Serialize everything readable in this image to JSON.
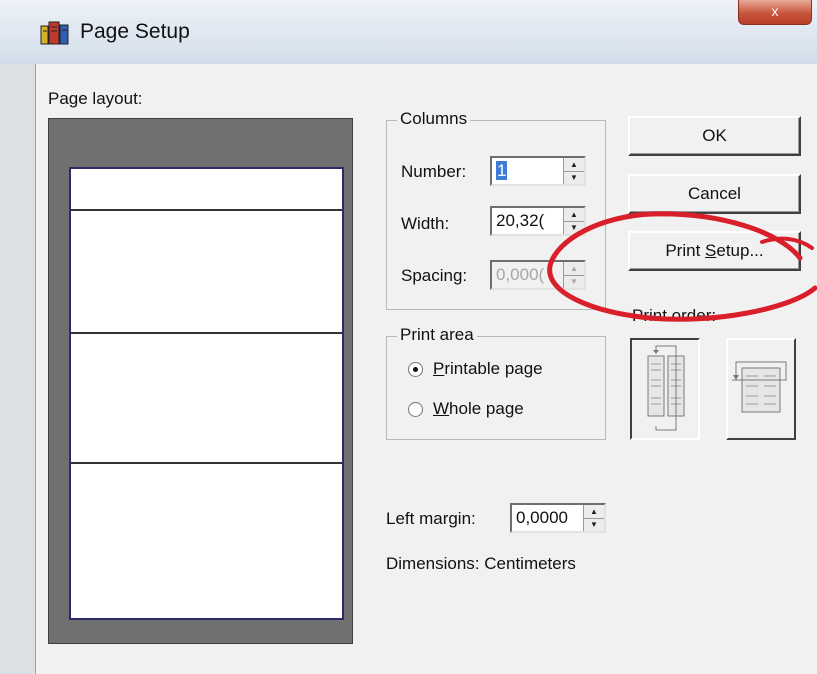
{
  "window": {
    "title": "Page Setup",
    "close_label": "x"
  },
  "page_layout": {
    "label": "Page layout:"
  },
  "columns": {
    "group_label": "Columns",
    "number_label": "Number:",
    "number_value": "1",
    "width_label": "Width:",
    "width_value": "20,32(",
    "spacing_label": "Spacing:",
    "spacing_value": "0,000("
  },
  "print_area": {
    "group_label": "Print area",
    "options": [
      {
        "label": "Printable page",
        "underline": "P",
        "rest": "rintable page",
        "selected": true
      },
      {
        "label": "Whole page",
        "underline": "W",
        "rest": "hole page",
        "selected": false
      }
    ]
  },
  "margin": {
    "left_margin_label": "Left margin:",
    "left_margin_value": "0,0000",
    "dimensions_text": "Dimensions: Centimeters"
  },
  "buttons": {
    "ok": "OK",
    "cancel": "Cancel",
    "print_setup_prefix": "Print ",
    "print_setup_underline": "S",
    "print_setup_suffix": "etup..."
  },
  "print_order": {
    "label": "Print order:",
    "selected": "down-then-over"
  },
  "colors": {
    "annotation_red": "#d81f2a",
    "selection_blue": "#3e7bd6"
  }
}
